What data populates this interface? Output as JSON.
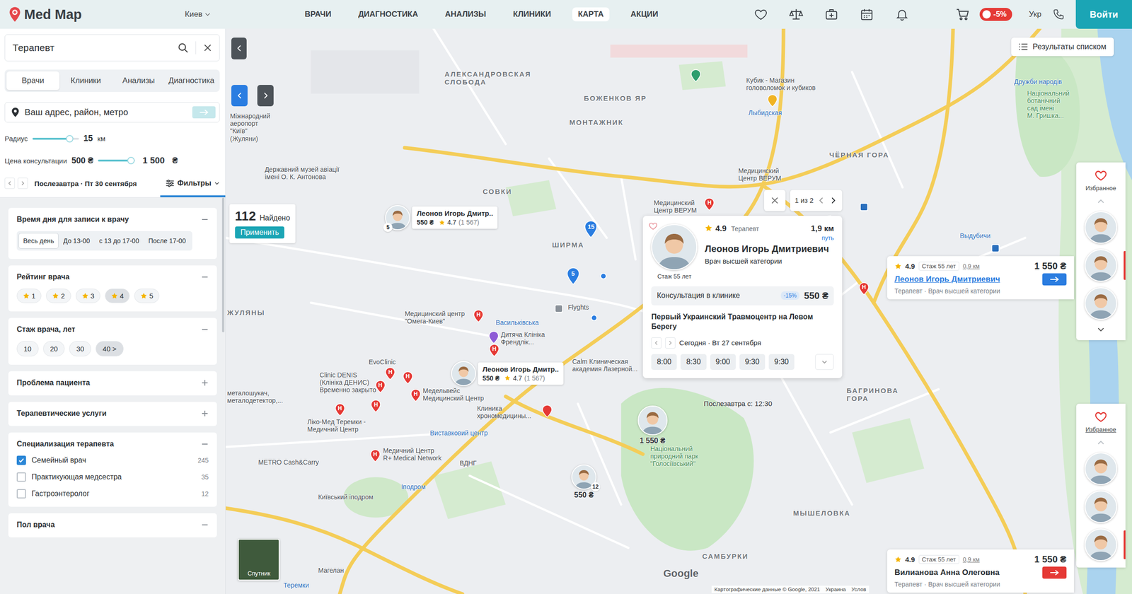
{
  "header": {
    "logo": "Med Map",
    "city": "Киев",
    "nav": [
      {
        "label": "ВРАЧИ",
        "selected": false
      },
      {
        "label": "ДИАГНОСТИКА",
        "selected": false
      },
      {
        "label": "АНАЛИЗЫ",
        "selected": false
      },
      {
        "label": "КЛИНИКИ",
        "selected": false
      },
      {
        "label": "КАРТА",
        "selected": true
      },
      {
        "label": "АКЦИИ",
        "selected": false
      }
    ],
    "discount": "-5%",
    "language": "Укр",
    "login": "Войти"
  },
  "search": {
    "value": "Терапевт"
  },
  "tabs": [
    {
      "label": "Врачи",
      "selected": true
    },
    {
      "label": "Клиники",
      "selected": false
    },
    {
      "label": "Анализы",
      "selected": false
    },
    {
      "label": "Диагностика",
      "selected": false
    }
  ],
  "address": {
    "placeholder": "Ваш адрес, район, метро"
  },
  "radius": {
    "label": "Радиус",
    "level": 0.8,
    "reading": "15",
    "unit": "км"
  },
  "price": {
    "label": "Цена консультации",
    "min": "500 ₴",
    "level": 0.88,
    "max": "1 500",
    "unit": "₴"
  },
  "dateNav": {
    "text": "Послезавтра · Пт 30 сентября",
    "filters": "Фильтры"
  },
  "filters": [
    {
      "kind": "chips",
      "title": "Время дня для записи к врачу",
      "expanded": true,
      "options": [
        {
          "label": "Весь день",
          "selected": true
        },
        {
          "label": "До 13-00",
          "selected": false
        },
        {
          "label": "с 13 до 17-00",
          "selected": false
        },
        {
          "label": "После 17-00",
          "selected": false
        }
      ]
    },
    {
      "kind": "stars",
      "title": "Рейтинг врача",
      "expanded": true,
      "options": [
        {
          "label": "1",
          "selected": false
        },
        {
          "label": "2",
          "selected": false
        },
        {
          "label": "3",
          "selected": false
        },
        {
          "label": "4",
          "selected": true
        },
        {
          "label": "5",
          "selected": false
        }
      ]
    },
    {
      "kind": "pills",
      "title": "Стаж врача, лет",
      "expanded": true,
      "options": [
        {
          "label": "10",
          "selected": false
        },
        {
          "label": "20",
          "selected": false
        },
        {
          "label": "30",
          "selected": false
        },
        {
          "label": "40 >",
          "selected": true
        }
      ]
    },
    {
      "kind": "none",
      "title": "Проблема пациента",
      "expanded": false,
      "options": []
    },
    {
      "kind": "none",
      "title": "Терапевтические услуги",
      "expanded": false,
      "options": []
    },
    {
      "kind": "checks",
      "title": "Специализация терапевта",
      "expanded": true,
      "options": [
        {
          "label": "Семейный врач",
          "count": "245",
          "checked": true
        },
        {
          "label": "Практикующая медсестра",
          "count": "35",
          "checked": false
        },
        {
          "label": "Гастроэнтеролог",
          "count": "12",
          "checked": false
        }
      ]
    },
    {
      "kind": "none",
      "title": "Пол врача",
      "expanded": true,
      "options": []
    }
  ],
  "map": {
    "mapNav": [
      {
        "kind": "prev",
        "selected": true
      },
      {
        "kind": "next",
        "selected": false
      }
    ],
    "found": {
      "count": "112",
      "label": "Найдено",
      "action": "Применить"
    },
    "listButton": "Результаты списком",
    "labels": [
      {
        "text": "АЛЕКСАНДРОВСКАЯ\nСЛОБОДА",
        "kind": "district"
      },
      {
        "text": "БОЖЕНКОВ ЯР",
        "kind": "district"
      },
      {
        "text": "МОНТАЖНИК",
        "kind": "district"
      },
      {
        "text": "СОВКИ",
        "kind": "district"
      },
      {
        "text": "ШИРМА",
        "kind": "district"
      },
      {
        "text": "ЖУЛЯНЫ",
        "kind": "district"
      },
      {
        "text": "ЧЁРНАЯ ГОРА",
        "kind": "district"
      },
      {
        "text": "БАГРИНОВА\nГОРА",
        "kind": "district"
      },
      {
        "text": "МЫШЕЛОВКА",
        "kind": "district"
      },
      {
        "text": "САМБУРКИ",
        "kind": "district"
      },
      {
        "text": "Міжнародний\nаеропорт\n\"Київ\"\n(Жуляни)",
        "kind": "place"
      },
      {
        "text": "Державний музей авіації\nімені О. К. Антонова",
        "kind": "place"
      },
      {
        "text": "Кубик - Магазин\nголоволомок и кубиков",
        "kind": "place"
      },
      {
        "text": "Лыбидская",
        "kind": "transit"
      },
      {
        "text": "Дружби народів",
        "kind": "transit"
      },
      {
        "text": "Національний\nботанічний\nсад імені\nМ. Гришка...",
        "kind": "park"
      },
      {
        "text": "Медицинский\nЦентр ВЕРУМ",
        "kind": "place"
      },
      {
        "text": "Медицинский\nЦентр ВЕРУМ",
        "kind": "place"
      },
      {
        "text": "Выдубичи",
        "kind": "transit"
      },
      {
        "text": "Медицинский центр\n\"Омега-Киев\"",
        "kind": "place"
      },
      {
        "text": "Васильківська",
        "kind": "transit"
      },
      {
        "text": "Flyghts",
        "kind": "place"
      },
      {
        "text": "Дитяча Клініка\nФрендлік...",
        "kind": "place"
      },
      {
        "text": "EvoClinic",
        "kind": "place"
      },
      {
        "text": "Clinic DENIS\n(Клініка ДЕНИС)\nВременно закрыто",
        "kind": "place"
      },
      {
        "text": "Медельвейс\nМедицинский Центр",
        "kind": "place"
      },
      {
        "text": "Calm Клиническая\nакадемия Лазерной...",
        "kind": "place"
      },
      {
        "text": "Клиника\nхрономедицины...",
        "kind": "place"
      },
      {
        "text": "Ліко-Мед Теремки -\nМедичний Центр",
        "kind": "place"
      },
      {
        "text": "Медичний Центр\nR+ Medical Network",
        "kind": "place"
      },
      {
        "text": "Виставковий центр",
        "kind": "transit"
      },
      {
        "text": "ВДНГ",
        "kind": "place"
      },
      {
        "text": "METRO Cash&Carry",
        "kind": "place"
      },
      {
        "text": "Київський іподром",
        "kind": "place"
      },
      {
        "text": "Іподром",
        "kind": "transit"
      },
      {
        "text": "Національний\nприродний парк\n\"Голосіївський\"",
        "kind": "park"
      },
      {
        "text": "Теремки",
        "kind": "transit"
      },
      {
        "text": "Магелан",
        "kind": "place"
      },
      {
        "text": "металошукач,\nметалодетектор,...",
        "kind": "place"
      }
    ],
    "markers": [
      {
        "kind": "pin",
        "glyph": "H",
        "color": "#e53935"
      },
      {
        "kind": "pin",
        "glyph": "H",
        "color": "#e53935"
      },
      {
        "kind": "pin",
        "glyph": "H",
        "color": "#e53935"
      },
      {
        "kind": "pin",
        "glyph": "H",
        "color": "#e53935"
      },
      {
        "kind": "pin",
        "glyph": "H",
        "color": "#e53935"
      },
      {
        "kind": "pin",
        "glyph": "H",
        "color": "#e53935"
      },
      {
        "kind": "pin",
        "glyph": "H",
        "color": "#e53935"
      },
      {
        "kind": "pin",
        "glyph": "H",
        "color": "#e53935"
      },
      {
        "kind": "pin",
        "glyph": "H",
        "color": "#e53935"
      },
      {
        "kind": "pin",
        "glyph": "",
        "color": "#e53935"
      },
      {
        "kind": "pin",
        "glyph": "H",
        "color": "#e53935"
      },
      {
        "kind": "pin",
        "glyph": "H",
        "color": "#e53935"
      },
      {
        "kind": "pin",
        "glyph": "",
        "color": "#8e5bd6"
      },
      {
        "kind": "pin",
        "glyph": "",
        "color": "#2e9e6e"
      },
      {
        "kind": "pin",
        "glyph": "",
        "color": "#f0b323"
      },
      {
        "kind": "stop",
        "glyph": "",
        "color": "#8a9199"
      },
      {
        "kind": "stop",
        "glyph": "",
        "color": "#2a6fbd"
      },
      {
        "kind": "stop",
        "glyph": "",
        "color": "#2a6fbd"
      }
    ],
    "clusters": [
      {
        "kind": "pin",
        "count": "15"
      },
      {
        "kind": "pin",
        "count": "5"
      },
      {
        "kind": "dot",
        "count": ""
      },
      {
        "kind": "dot",
        "count": ""
      }
    ],
    "doctors": [
      {
        "kind": "card",
        "name": "Леонов Игорь Дмитр..",
        "price": "550 ₴",
        "rating": "4.7",
        "reviews": "(1 567)",
        "badge": "5"
      },
      {
        "kind": "card",
        "name": "Леонов Игорь Дмитр..",
        "price": "550 ₴",
        "rating": "4.7",
        "reviews": "(1 567)",
        "badge": ""
      },
      {
        "kind": "price",
        "name": "",
        "price": "1 550 ₴",
        "rating": "",
        "reviews": "",
        "badge": ""
      },
      {
        "kind": "price",
        "name": "",
        "price": "550 ₴",
        "rating": "",
        "reviews": "",
        "badge": "12"
      }
    ],
    "popup": {
      "pager": "1 из 2",
      "favorite": false,
      "rating": "4.9",
      "specialty": "Терапевт",
      "distance": "1,9 км",
      "route": "путь",
      "experience": "Стаж 55 лет",
      "name": "Леонов Игорь Дмитриевич",
      "category": "Врач высшей категории",
      "consultation": {
        "label": "Консультация в клинике",
        "discount": "-15%",
        "price": "550 ₴"
      },
      "clinic": "Первый Украинский Травмоцентр на Левом Берегу",
      "day": "Сегодня · Вт 27 сентября",
      "times": [
        "8:00",
        "8:30",
        "9:00",
        "9:30",
        "9:30"
      ],
      "next": "Послезавтра с: 12:30"
    },
    "cards": [
      {
        "rating": "4.9",
        "experience": "Стаж 55 лет",
        "distance": "0,9 км",
        "price": "1 550 ₴",
        "name": "Леонов Игорь Дмитриевич",
        "meta": "Терапевт · Врач высшей категории",
        "selected": true,
        "color": "#2b7de0"
      },
      {
        "rating": "4.9",
        "experience": "Стаж 55 лет",
        "distance": "0,9 км",
        "price": "1 550 ₴",
        "name": "Вилианова Анна Олеговна",
        "meta": "Терапевт · Врач высшей категории",
        "selected": false,
        "color": "#e53935"
      }
    ],
    "favorites": [
      {
        "title": "Избранное",
        "underlined": false,
        "scrollDown": true,
        "avatars": [
          {
            "selected": false
          },
          {
            "selected": true
          },
          {
            "selected": false
          }
        ]
      },
      {
        "title": "Избранное",
        "underlined": true,
        "scrollDown": false,
        "avatars": [
          {
            "selected": false
          },
          {
            "selected": false
          },
          {
            "selected": true
          }
        ]
      }
    ],
    "satellite": "Спутник",
    "google": "Google",
    "attribution": [
      "Картографические данные © Google, 2021",
      "Украина",
      "Услов"
    ]
  }
}
